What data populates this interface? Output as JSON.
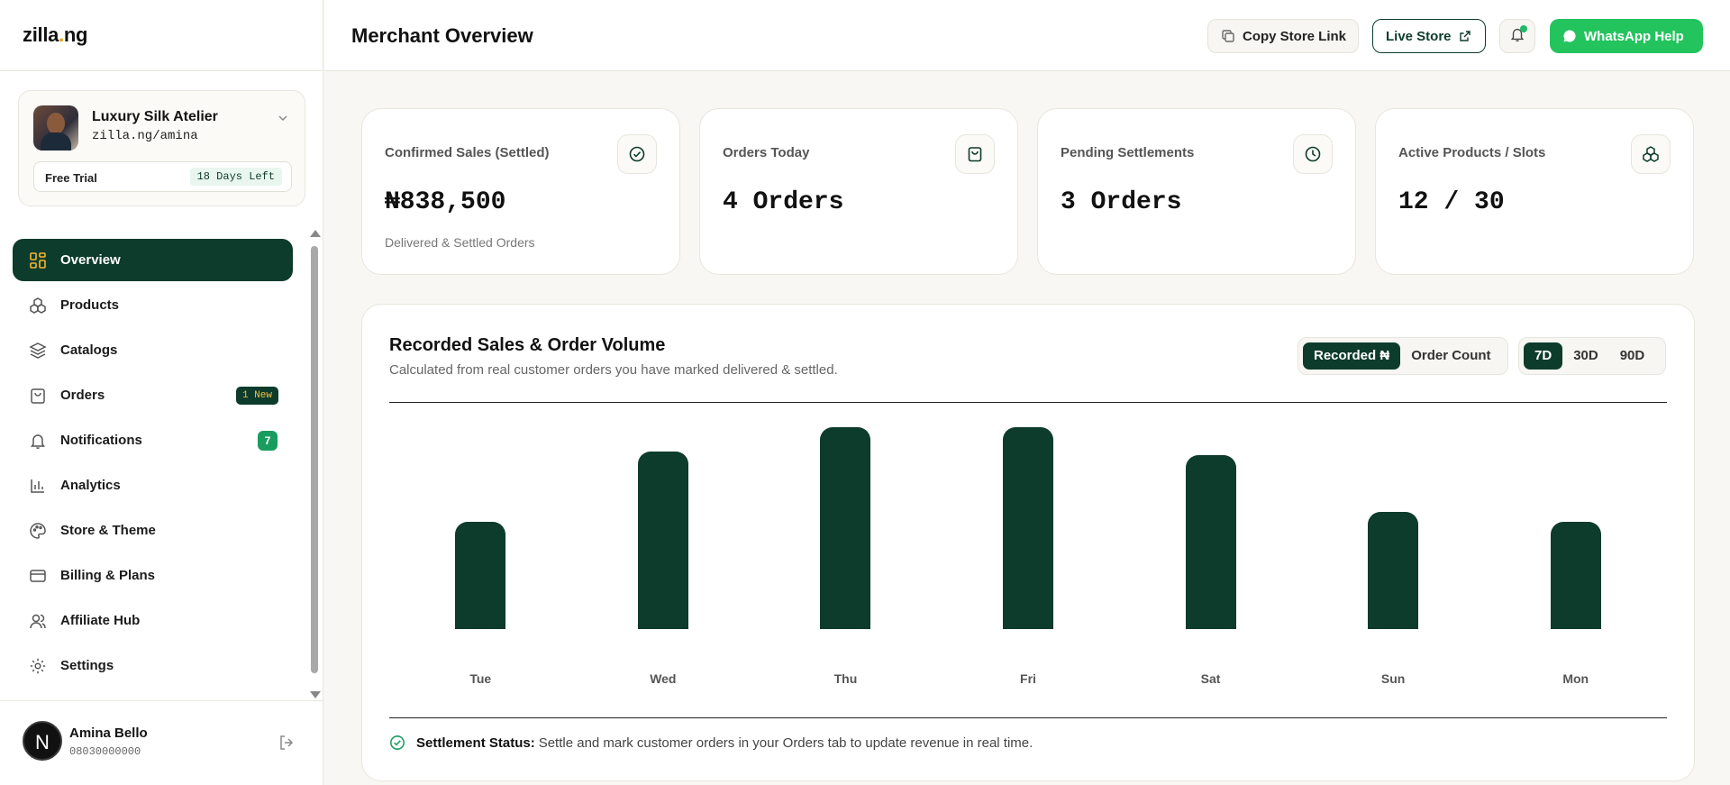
{
  "brand": {
    "logo_main": "zilla",
    "logo_dot": ".",
    "logo_end": "ng"
  },
  "store": {
    "name": "Luxury Silk Atelier",
    "url": "zilla.ng/amina",
    "trial_label": "Free Trial",
    "trial_days": "18 Days Left"
  },
  "nav": [
    {
      "label": "Overview",
      "icon": "grid-icon",
      "active": true
    },
    {
      "label": "Products",
      "icon": "products-icon"
    },
    {
      "label": "Catalogs",
      "icon": "layers-icon"
    },
    {
      "label": "Orders",
      "icon": "bag-icon",
      "badge": "1 New"
    },
    {
      "label": "Notifications",
      "icon": "bell-icon",
      "count": "7"
    },
    {
      "label": "Analytics",
      "icon": "chart-icon"
    },
    {
      "label": "Store & Theme",
      "icon": "palette-icon"
    },
    {
      "label": "Billing & Plans",
      "icon": "card-icon"
    },
    {
      "label": "Affiliate Hub",
      "icon": "users-icon"
    },
    {
      "label": "Settings",
      "icon": "gear-icon"
    }
  ],
  "user": {
    "initial": "N",
    "name": "Amina Bello",
    "phone": "08030000000"
  },
  "header": {
    "title": "Merchant Overview",
    "copy_link": "Copy Store Link",
    "live_store": "Live Store",
    "whatsapp": "WhatsApp Help"
  },
  "stats": [
    {
      "label": "Confirmed Sales (Settled)",
      "value": "₦838,500",
      "sub": "Delivered & Settled Orders",
      "icon": "check-circle-icon"
    },
    {
      "label": "Orders Today",
      "value": "4 Orders",
      "sub": "",
      "icon": "bag-icon"
    },
    {
      "label": "Pending Settlements",
      "value": "3 Orders",
      "sub": "",
      "icon": "clock-icon"
    },
    {
      "label": "Active Products / Slots",
      "value": "12 / 30",
      "sub": "",
      "icon": "products-icon"
    }
  ],
  "chart": {
    "title": "Recorded Sales & Order Volume",
    "subtitle": "Calculated from real customer orders you have marked delivered & settled.",
    "metric_options": [
      "Recorded ₦",
      "Order Count"
    ],
    "metric_selected": "Recorded ₦",
    "range_options": [
      "7D",
      "30D",
      "90D"
    ],
    "range_selected": "7D",
    "settlement_label": "Settlement Status:",
    "settlement_text": "Settle and mark customer orders in your Orders tab to update revenue in real time."
  },
  "chart_data": {
    "type": "bar",
    "categories": [
      "Tue",
      "Wed",
      "Thu",
      "Fri",
      "Sat",
      "Sun",
      "Mon"
    ],
    "values": [
      53,
      88,
      100,
      100,
      86,
      58,
      53
    ],
    "ylim": [
      0,
      100
    ],
    "grid": false,
    "color": "#0d3b2c"
  },
  "colors": {
    "primary": "#0d3b2c",
    "accent": "#f3b730",
    "whatsapp": "#23c45e",
    "success": "#1a9c5e"
  }
}
